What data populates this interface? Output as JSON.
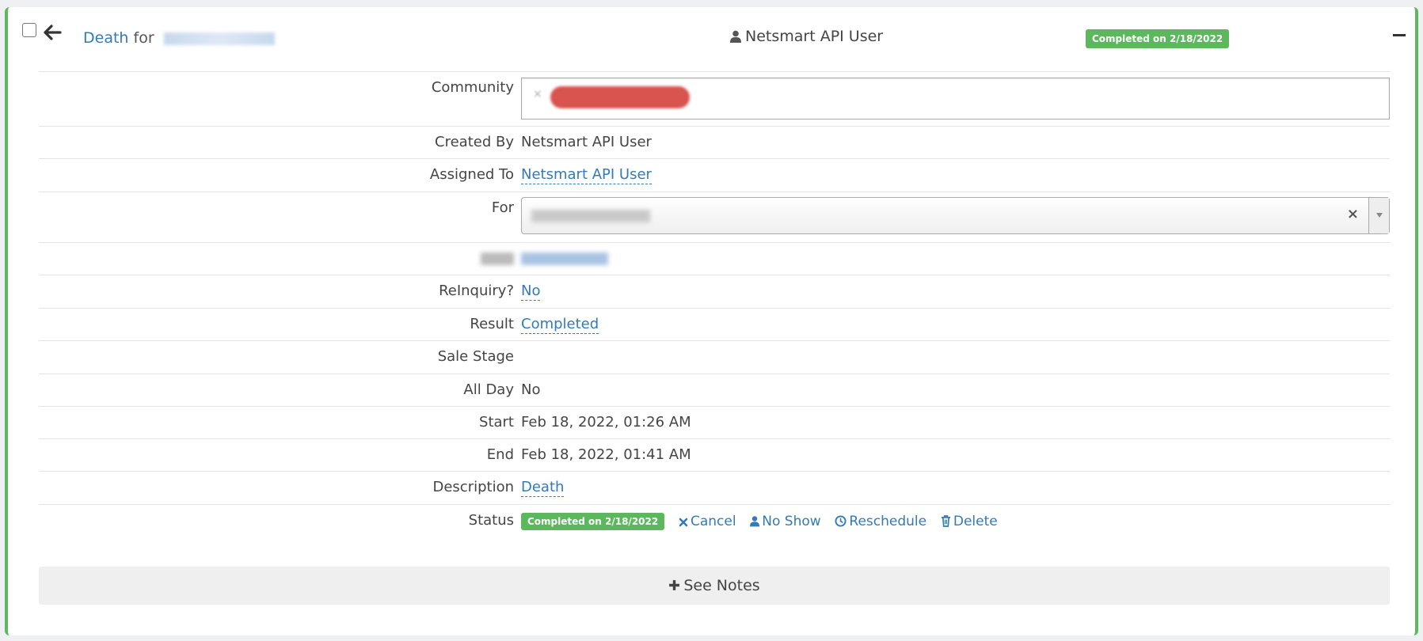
{
  "header": {
    "title_link": "Death",
    "title_for": "for",
    "owner": "Netsmart API User",
    "status_badge": "Completed on 2/18/2022"
  },
  "fields": {
    "community_label": "Community",
    "created_by_label": "Created By",
    "created_by_value": "Netsmart API User",
    "assigned_to_label": "Assigned To",
    "assigned_to_value": "Netsmart API User",
    "for_label": "For",
    "reinquiry_label": "ReInquiry?",
    "reinquiry_value": "No",
    "result_label": "Result",
    "result_value": "Completed",
    "sale_stage_label": "Sale Stage",
    "all_day_label": "All Day",
    "all_day_value": "No",
    "start_label": "Start",
    "start_value": "Feb 18, 2022, 01:26 AM",
    "end_label": "End",
    "end_value": "Feb 18, 2022, 01:41 AM",
    "description_label": "Description",
    "description_value": "Death",
    "status_label": "Status",
    "status_badge": "Completed on 2/18/2022"
  },
  "actions": {
    "cancel": "Cancel",
    "no_show": "No Show",
    "reschedule": "Reschedule",
    "delete": "Delete"
  },
  "notes_button": "See Notes",
  "colors": {
    "accent_green": "#5cb85c",
    "link_blue": "#337ab7",
    "tag_red": "#d9534f"
  }
}
